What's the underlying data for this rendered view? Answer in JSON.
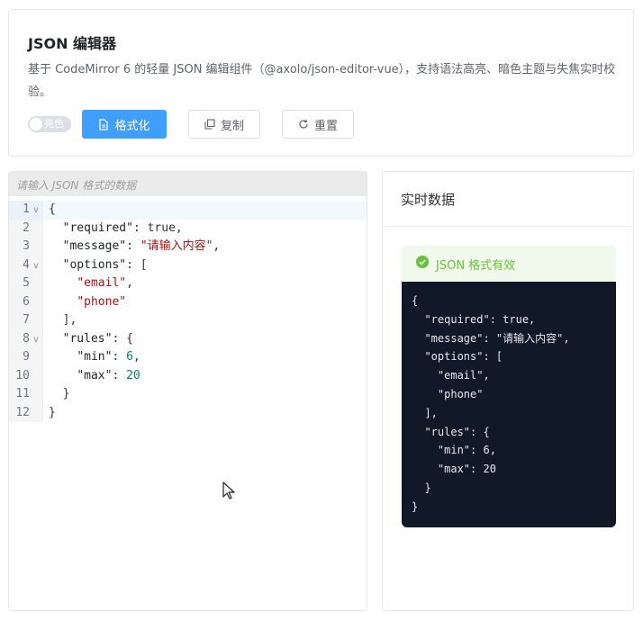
{
  "header": {
    "title": "JSON 编辑器",
    "description": "基于 CodeMirror 6 的轻量 JSON 编辑组件（@axolo/json-editor-vue），支持语法高亮、暗色主题与失焦实时校验。"
  },
  "toolbar": {
    "theme_switch_label": "亮色",
    "format_label": "格式化",
    "copy_label": "复制",
    "reset_label": "重置"
  },
  "editor": {
    "placeholder": "请输入 JSON 格式的数据",
    "line_numbers": [
      "1",
      "2",
      "3",
      "4",
      "5",
      "6",
      "7",
      "8",
      "9",
      "10",
      "11",
      "12"
    ],
    "fold_marker": "v",
    "lines": [
      {
        "parts": [
          {
            "t": "b",
            "v": "{"
          }
        ],
        "fold": true
      },
      {
        "parts": [
          {
            "t": "b",
            "v": "  "
          },
          {
            "t": "k",
            "v": "\"required\""
          },
          {
            "t": "b",
            "v": ": "
          },
          {
            "t": "b",
            "v": "true"
          },
          {
            "t": "b",
            "v": ","
          }
        ]
      },
      {
        "parts": [
          {
            "t": "b",
            "v": "  "
          },
          {
            "t": "k",
            "v": "\"message\""
          },
          {
            "t": "b",
            "v": ": "
          },
          {
            "t": "s",
            "v": "\"请输入内容\""
          },
          {
            "t": "b",
            "v": ","
          }
        ]
      },
      {
        "parts": [
          {
            "t": "b",
            "v": "  "
          },
          {
            "t": "k",
            "v": "\"options\""
          },
          {
            "t": "b",
            "v": ": ["
          }
        ],
        "fold": true
      },
      {
        "parts": [
          {
            "t": "b",
            "v": "    "
          },
          {
            "t": "s",
            "v": "\"email\""
          },
          {
            "t": "b",
            "v": ","
          }
        ]
      },
      {
        "parts": [
          {
            "t": "b",
            "v": "    "
          },
          {
            "t": "s",
            "v": "\"phone\""
          }
        ]
      },
      {
        "parts": [
          {
            "t": "b",
            "v": "  ],"
          }
        ]
      },
      {
        "parts": [
          {
            "t": "b",
            "v": "  "
          },
          {
            "t": "k",
            "v": "\"rules\""
          },
          {
            "t": "b",
            "v": ": {"
          }
        ],
        "fold": true
      },
      {
        "parts": [
          {
            "t": "b",
            "v": "    "
          },
          {
            "t": "k",
            "v": "\"min\""
          },
          {
            "t": "b",
            "v": ": "
          },
          {
            "t": "n",
            "v": "6"
          },
          {
            "t": "b",
            "v": ","
          }
        ]
      },
      {
        "parts": [
          {
            "t": "b",
            "v": "    "
          },
          {
            "t": "k",
            "v": "\"max\""
          },
          {
            "t": "b",
            "v": ": "
          },
          {
            "t": "n",
            "v": "20"
          }
        ]
      },
      {
        "parts": [
          {
            "t": "b",
            "v": "  }"
          }
        ]
      },
      {
        "parts": [
          {
            "t": "b",
            "v": "}"
          }
        ]
      }
    ]
  },
  "data_panel": {
    "title": "实时数据",
    "status_text": "JSON 格式有效",
    "json_text": "{\n  \"required\": true,\n  \"message\": \"请输入内容\",\n  \"options\": [\n    \"email\",\n    \"phone\"\n  ],\n  \"rules\": {\n    \"min\": 6,\n    \"max\": 20\n  }\n}"
  },
  "colors": {
    "primary": "#409eff",
    "success": "#67c23a",
    "code_bg": "#111827"
  }
}
